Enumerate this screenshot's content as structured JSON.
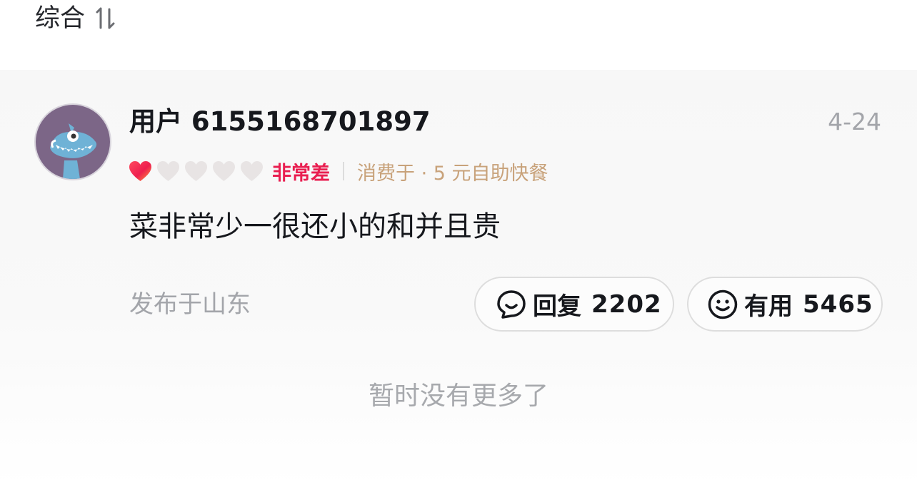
{
  "sort": {
    "label": "综合",
    "icon": "sort-arrows-icon"
  },
  "review": {
    "username": "用户 6155168701897",
    "date": "4-24",
    "rating": {
      "value": 1,
      "max": 5,
      "text": "非常差",
      "filled_color": "#f0294f",
      "empty_color": "#e8e4e4"
    },
    "consume": "消费于 · 5 元自助快餐",
    "content": "菜非常少一很还小的和并且贵",
    "location": "发布于山东",
    "reply": {
      "label": "回复",
      "count": "2202",
      "icon": "chat-bubble-icon"
    },
    "useful": {
      "label": "有用",
      "count": "5465",
      "icon": "smiley-icon"
    }
  },
  "footer": {
    "no_more": "暂时没有更多了"
  },
  "colors": {
    "accent_red": "#e91e50",
    "consume_gold": "#c8a27a",
    "muted_gray": "#a3a5aa"
  }
}
